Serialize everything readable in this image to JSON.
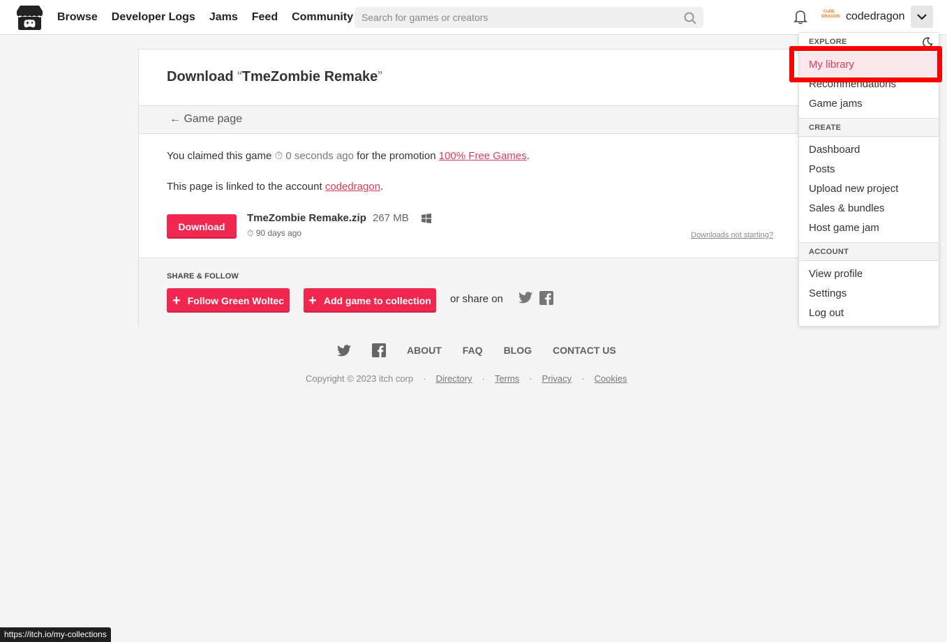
{
  "header": {
    "nav": [
      "Browse",
      "Developer Logs",
      "Jams",
      "Feed",
      "Community"
    ],
    "search_placeholder": "Search for games or creators",
    "avatar_text": "CoDE DRAGON",
    "username": "codedragon"
  },
  "download": {
    "title_prefix": "Download",
    "open_quote": "“",
    "game_title": "TmeZombie Remake",
    "close_quote": "”",
    "back_link": "Game page",
    "claim_prefix": "You claimed this game",
    "claim_time": "0 seconds ago",
    "claim_middle": "for the promotion",
    "promotion": "100% Free Games",
    "claim_suffix": ".",
    "account_prefix": "This page is linked to the account",
    "account_name": "codedragon",
    "account_suffix": ".",
    "download_button": "Download",
    "file_name": "TmeZombie Remake.zip",
    "file_size": "267 MB",
    "file_age": "90 days ago",
    "not_starting": "Downloads not starting?"
  },
  "share": {
    "label": "SHARE & FOLLOW",
    "follow_button": "Follow Green Woltec",
    "collection_button": "Add game to collection",
    "share_on": "or share on"
  },
  "footer": {
    "links": [
      "ABOUT",
      "FAQ",
      "BLOG",
      "CONTACT US"
    ],
    "copyright": "Copyright © 2023 itch corp",
    "legal": [
      "Directory",
      "Terms",
      "Privacy",
      "Cookies"
    ],
    "separator": "·"
  },
  "dropdown": {
    "explore_label": "EXPLORE",
    "explore_items": [
      "My library",
      "Recommendations",
      "Game jams"
    ],
    "create_label": "CREATE",
    "create_items": [
      "Dashboard",
      "Posts",
      "Upload new project",
      "Sales & bundles",
      "Host game jam"
    ],
    "account_label": "ACCOUNT",
    "account_items": [
      "View profile",
      "Settings",
      "Log out"
    ]
  },
  "statusbar": {
    "url": "https://itch.io/my-collections"
  },
  "colors": {
    "accent": "#f2274f",
    "link": "#d83d5a",
    "highlight": "#ff0000"
  }
}
